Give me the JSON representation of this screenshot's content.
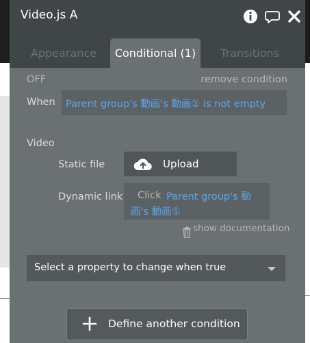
{
  "window": {
    "title": "Video.js A"
  },
  "tabs": [
    {
      "label": "Appearance",
      "active": false
    },
    {
      "label": "Conditional (1)",
      "active": true
    },
    {
      "label": "Transitions",
      "active": false
    }
  ],
  "condition": {
    "status": "OFF",
    "remove_label": "remove condition",
    "when_label": "When",
    "expression": "Parent group's 動画's 動画① is not empty"
  },
  "video": {
    "section_label": "Video",
    "static_file_label": "Static file",
    "upload_label": "Upload",
    "dynamic_link_label": "Dynamic link",
    "dynamic_prefix": "Click",
    "dynamic_value": "Parent group's 動画's 動画①",
    "show_documentation": "show documentation"
  },
  "property_select": {
    "placeholder": "Select a property to change when true"
  },
  "define_button": {
    "label": "Define another condition"
  },
  "icons": {
    "info": "info-icon",
    "comment": "comment-icon",
    "close": "close-icon",
    "upload": "cloud-upload-icon",
    "trash": "trash-icon",
    "caret": "caret-down-icon",
    "plus": "plus-icon"
  },
  "colors": {
    "panel": "#6b7073",
    "header": "#404547",
    "link": "#58a6ee"
  }
}
